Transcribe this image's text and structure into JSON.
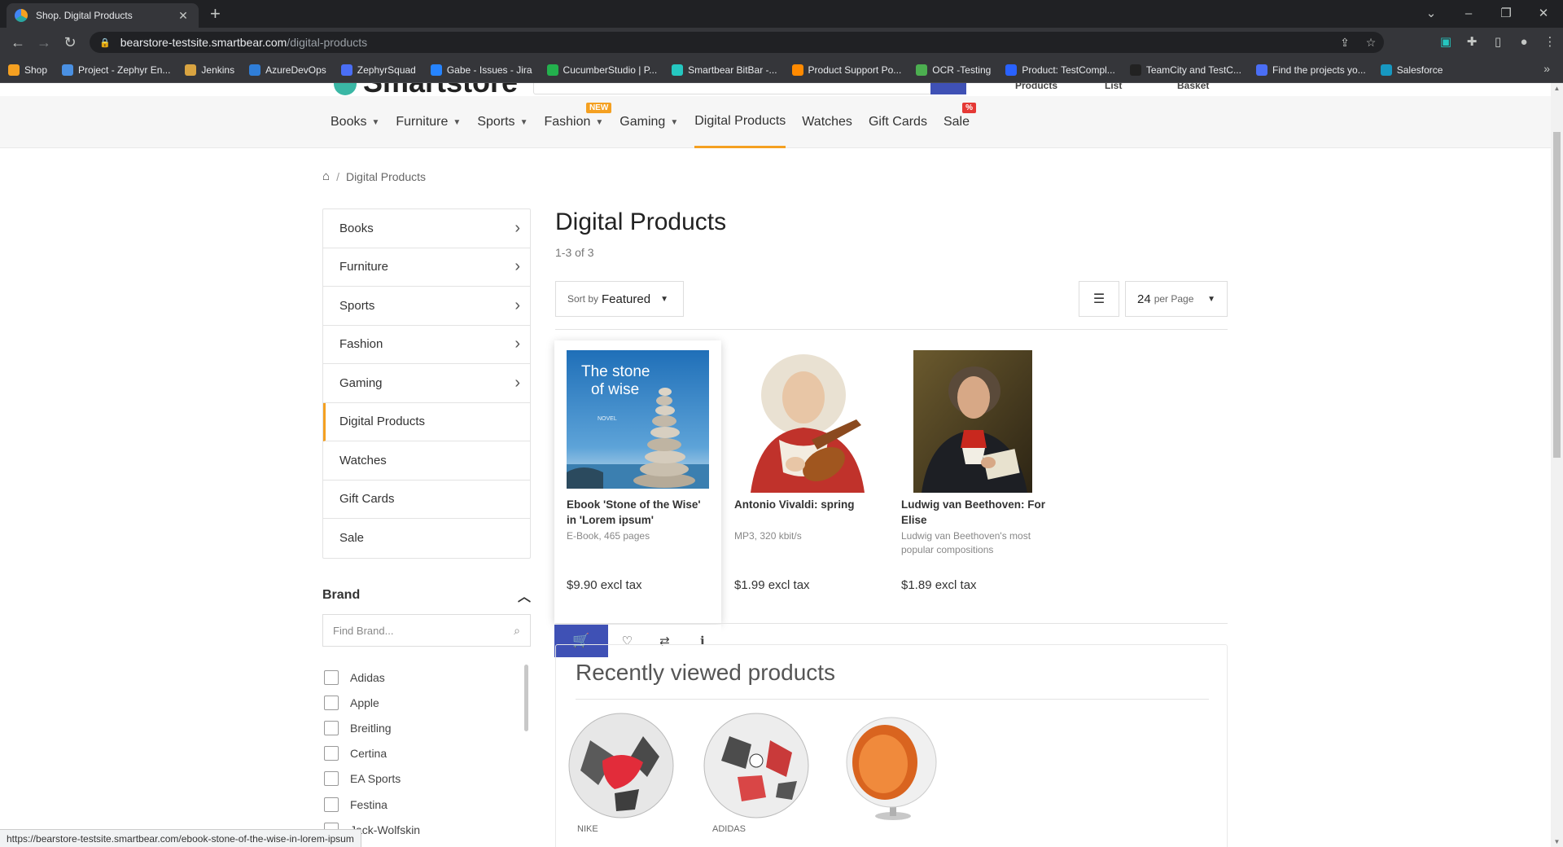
{
  "browser": {
    "tab_title": "Shop. Digital Products",
    "url_host": "bearstore-testsite.smartbear.com",
    "url_path": "/digital-products",
    "bookmarks": [
      {
        "label": "Shop",
        "color": "#f4a021"
      },
      {
        "label": "Project - Zephyr En...",
        "color": "#4a90e2"
      },
      {
        "label": "Jenkins",
        "color": "#d9a441"
      },
      {
        "label": "AzureDevOps",
        "color": "#2f7ed8"
      },
      {
        "label": "ZephyrSquad",
        "color": "#4a6ef5"
      },
      {
        "label": "Gabe - Issues - Jira",
        "color": "#2684ff"
      },
      {
        "label": "CucumberStudio | P...",
        "color": "#23b14d"
      },
      {
        "label": "Smartbear BitBar -...",
        "color": "#25c7c0"
      },
      {
        "label": "Product Support Po...",
        "color": "#ff8a00"
      },
      {
        "label": "OCR -Testing",
        "color": "#4caf50"
      },
      {
        "label": "Product: TestCompl...",
        "color": "#2962ff"
      },
      {
        "label": "TeamCity and TestC...",
        "color": "#222222"
      },
      {
        "label": "Find the projects yo...",
        "color": "#4a6ef5"
      },
      {
        "label": "Salesforce",
        "color": "#1798c1"
      }
    ],
    "status_url": "https://bearstore-testsite.smartbear.com/ebook-stone-of-the-wise-in-lorem-ipsum"
  },
  "header": {
    "logo_text": "Smartstore",
    "links": [
      "Products",
      "List",
      "Basket"
    ]
  },
  "nav": {
    "categories": [
      {
        "label": "Books",
        "dropdown": true
      },
      {
        "label": "Furniture",
        "dropdown": true
      },
      {
        "label": "Sports",
        "dropdown": true
      },
      {
        "label": "Fashion",
        "dropdown": true,
        "badge": "NEW"
      },
      {
        "label": "Gaming",
        "dropdown": true
      },
      {
        "label": "Digital Products",
        "dropdown": false,
        "active": true
      },
      {
        "label": "Watches",
        "dropdown": false
      },
      {
        "label": "Gift Cards",
        "dropdown": false
      },
      {
        "label": "Sale",
        "dropdown": false,
        "badge": "%"
      }
    ]
  },
  "breadcrumb": {
    "current": "Digital Products"
  },
  "sidebar": {
    "items": [
      {
        "label": "Books",
        "has_children": true
      },
      {
        "label": "Furniture",
        "has_children": true
      },
      {
        "label": "Sports",
        "has_children": true
      },
      {
        "label": "Fashion",
        "has_children": true
      },
      {
        "label": "Gaming",
        "has_children": true
      },
      {
        "label": "Digital Products",
        "has_children": false,
        "active": true
      },
      {
        "label": "Watches",
        "has_children": false
      },
      {
        "label": "Gift Cards",
        "has_children": false
      },
      {
        "label": "Sale",
        "has_children": false
      }
    ],
    "brand_heading": "Brand",
    "brand_search_placeholder": "Find Brand...",
    "brands": [
      "Adidas",
      "Apple",
      "Breitling",
      "Certina",
      "EA Sports",
      "Festina",
      "Jack-Wolfskin"
    ]
  },
  "main": {
    "title": "Digital Products",
    "count": "1-3 of 3",
    "sort_label": "Sort by",
    "sort_value": "Featured",
    "per_page_value": "24",
    "per_page_label": "per Page",
    "products": [
      {
        "name": "Ebook 'Stone of the Wise' in 'Lorem ipsum'",
        "desc": "E-Book, 465 pages",
        "price": "$9.90 excl tax",
        "cover_title": "The stone of wise",
        "cover_sub": "NOVEL"
      },
      {
        "name": "Antonio Vivaldi: spring",
        "desc": "MP3, 320 kbit/s",
        "price": "$1.99 excl tax"
      },
      {
        "name": "Ludwig van Beethoven: For Elise",
        "desc": "Ludwig van Beethoven's most popular compositions",
        "price": "$1.89 excl tax"
      }
    ],
    "recently_viewed_title": "Recently viewed products",
    "recently_viewed": [
      {
        "brand": "NIKE"
      },
      {
        "brand": "ADIDAS"
      },
      {
        "brand": ""
      }
    ]
  },
  "colors": {
    "accent": "#f4a021",
    "primary": "#3f51b5",
    "sale_badge": "#e53935"
  }
}
